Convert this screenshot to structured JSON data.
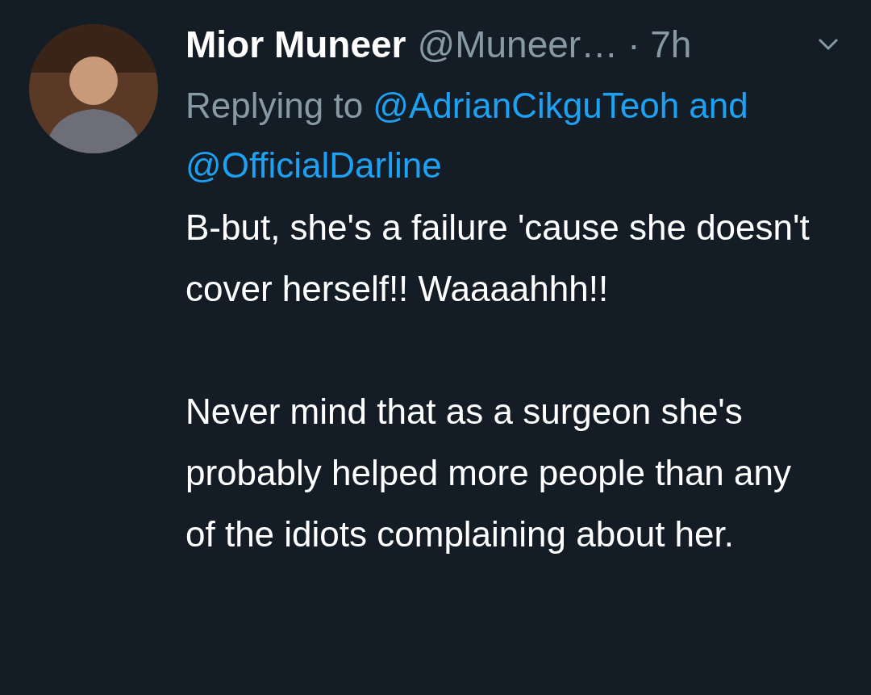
{
  "tweet": {
    "author": {
      "name": "Mior Muneer",
      "handle": "@Muneer…",
      "time": "· 7h"
    },
    "replying": {
      "prefix": "Replying to",
      "mentions": [
        "@AdrianCikguTeoh",
        "@OfficialDarline"
      ],
      "joiner": "and"
    },
    "body": [
      "B-but, she's a failure 'cause she doesn't cover herself!! Waaaahhh!!",
      "Never mind that as a surgeon she's probably helped more people than any of the idiots complaining about her."
    ]
  }
}
